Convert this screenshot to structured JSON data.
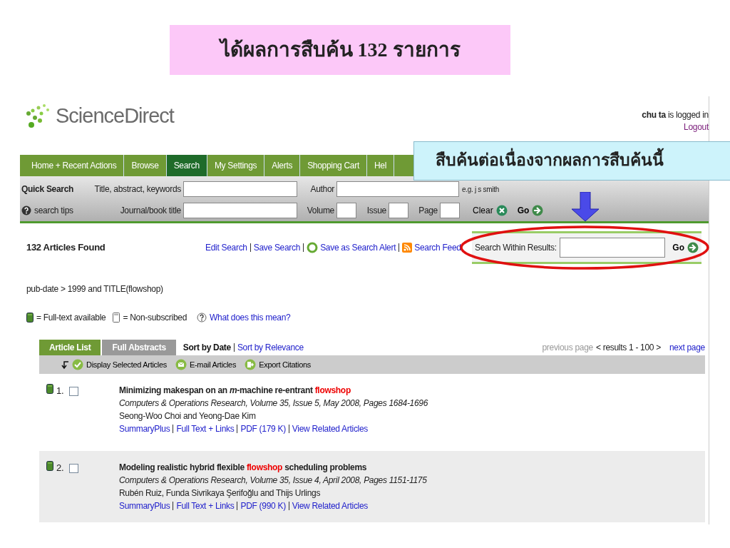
{
  "slide_title": "ได้ผลการสืบค้น 132 รายการ",
  "header": {
    "logo": "ScienceDirect",
    "user": "chu ta",
    "user_status": "is logged in",
    "logout": "Logout"
  },
  "nav": [
    {
      "label": "Home + Recent Actions",
      "selected": false
    },
    {
      "label": "Browse",
      "selected": false
    },
    {
      "label": "Search",
      "selected": true
    },
    {
      "label": "My Settings",
      "selected": false
    },
    {
      "label": "Alerts",
      "selected": false
    },
    {
      "label": "Shopping Cart",
      "selected": false
    },
    {
      "label": "Hel",
      "selected": false
    }
  ],
  "callout": "สืบค้นต่อเนื่องจากผลการสืบค้นนี้",
  "quick_search": {
    "title": "Quick Search",
    "tips": "search tips",
    "title_field": "Title, abstract, keywords",
    "author_field": "Author",
    "author_hint": "e.g. j s smith",
    "journal_field": "Journal/book title",
    "volume_field": "Volume",
    "issue_field": "Issue",
    "page_field": "Page",
    "clear": "Clear",
    "go": "Go"
  },
  "results_header": {
    "count": "132 Articles Found",
    "links": [
      "Edit Search",
      "Save Search",
      "Save as Search Alert",
      "Search Feed"
    ],
    "within_label": "Search Within Results:",
    "go": "Go"
  },
  "query": "pub-date > 1999 and TITLE(flowshop)",
  "legend": {
    "full_text": "= Full-text available",
    "non_subscribed": "= Non-subscribed",
    "help": "What does this mean?"
  },
  "view_tabs": [
    {
      "label": "Article List",
      "selected": true
    },
    {
      "label": "Full Abstracts",
      "selected": false
    }
  ],
  "sort": [
    {
      "label": "Sort by Date",
      "selected": true
    },
    {
      "label": "Sort by Relevance",
      "selected": false
    }
  ],
  "paging": {
    "previous": "previous page",
    "range": "< results 1 - 100 >",
    "next": "next page"
  },
  "actions": [
    "Display Selected Articles",
    "E-mail Articles",
    "Export Citations"
  ],
  "articles": [
    {
      "number": "1.",
      "checked": false,
      "title": [
        {
          "text": "Minimizing makespan on an *m*-machine re-entrant ",
          "highlight": false
        },
        {
          "text": "flowshop",
          "highlight": true
        }
      ],
      "source": "Computers & Operations Research, Volume 35, Issue 5, May 2008, Pages 1684-1696",
      "authors": "Seong-Woo Choi and Yeong-Dae Kim",
      "links": [
        "SummaryPlus",
        "Full Text + Links",
        "PDF (179 K)",
        "View Related Articles"
      ]
    },
    {
      "number": "2.",
      "checked": false,
      "title": [
        {
          "text": "Modeling realistic hybrid flexible ",
          "highlight": false
        },
        {
          "text": "flowshop",
          "highlight": true
        },
        {
          "text": " scheduling problems",
          "highlight": false
        }
      ],
      "source": "Computers & Operations Research, Volume 35, Issue 4, April 2008, Pages 1151-1175",
      "authors": "Rubén Ruiz, Funda Sivrikaya Şerifoğlu and Thijs Urlings",
      "links": [
        "SummaryPlus",
        "Full Text + Links",
        "PDF (990 K)",
        "View Related Articles"
      ]
    }
  ]
}
